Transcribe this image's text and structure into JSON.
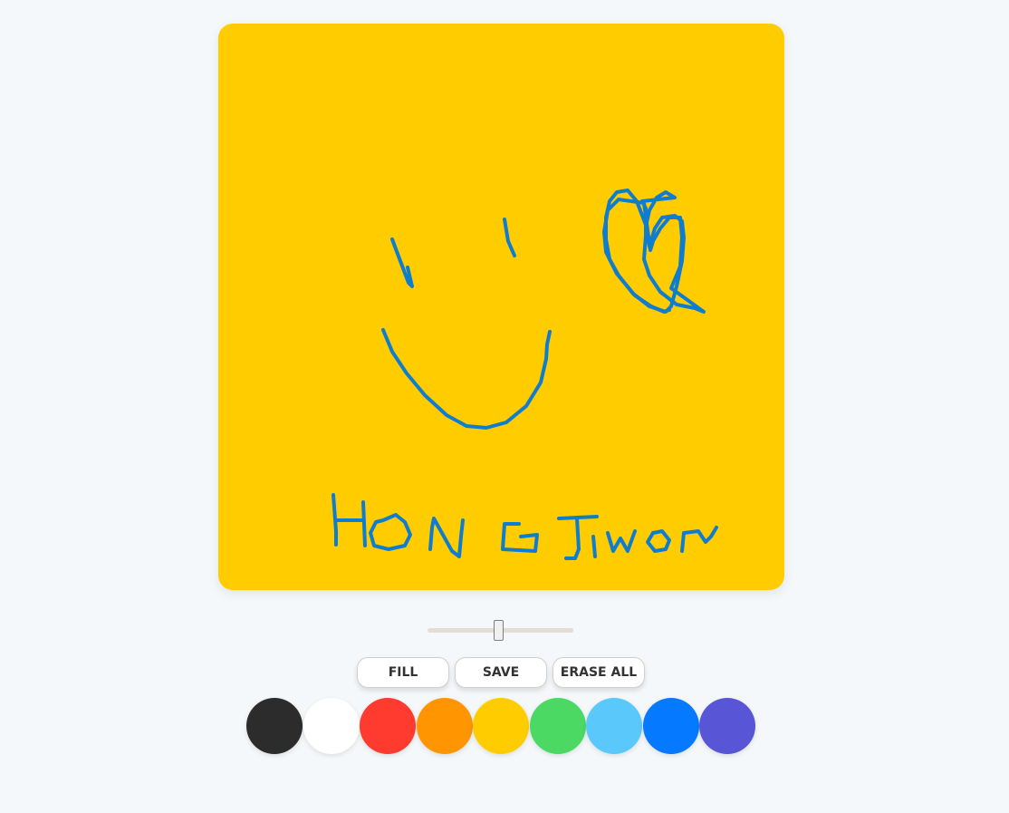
{
  "canvas": {
    "background_color": "#ffcc00",
    "stroke_color": "#0f7dcf"
  },
  "brush_size": {
    "fraction": 0.49
  },
  "buttons": {
    "fill_label": "FILL",
    "save_label": "SAVE",
    "erase_all_label": "ERASE ALL"
  },
  "palette": [
    {
      "name": "black",
      "color": "#2c2c2c"
    },
    {
      "name": "white",
      "color": "#ffffff"
    },
    {
      "name": "red",
      "color": "#ff3b30"
    },
    {
      "name": "orange",
      "color": "#ff9500"
    },
    {
      "name": "yellow",
      "color": "#ffcc00"
    },
    {
      "name": "green",
      "color": "#4cd963"
    },
    {
      "name": "sky-blue",
      "color": "#5ac8fa"
    },
    {
      "name": "blue",
      "color": "#0579ff"
    },
    {
      "name": "purple",
      "color": "#5856d6"
    }
  ]
}
